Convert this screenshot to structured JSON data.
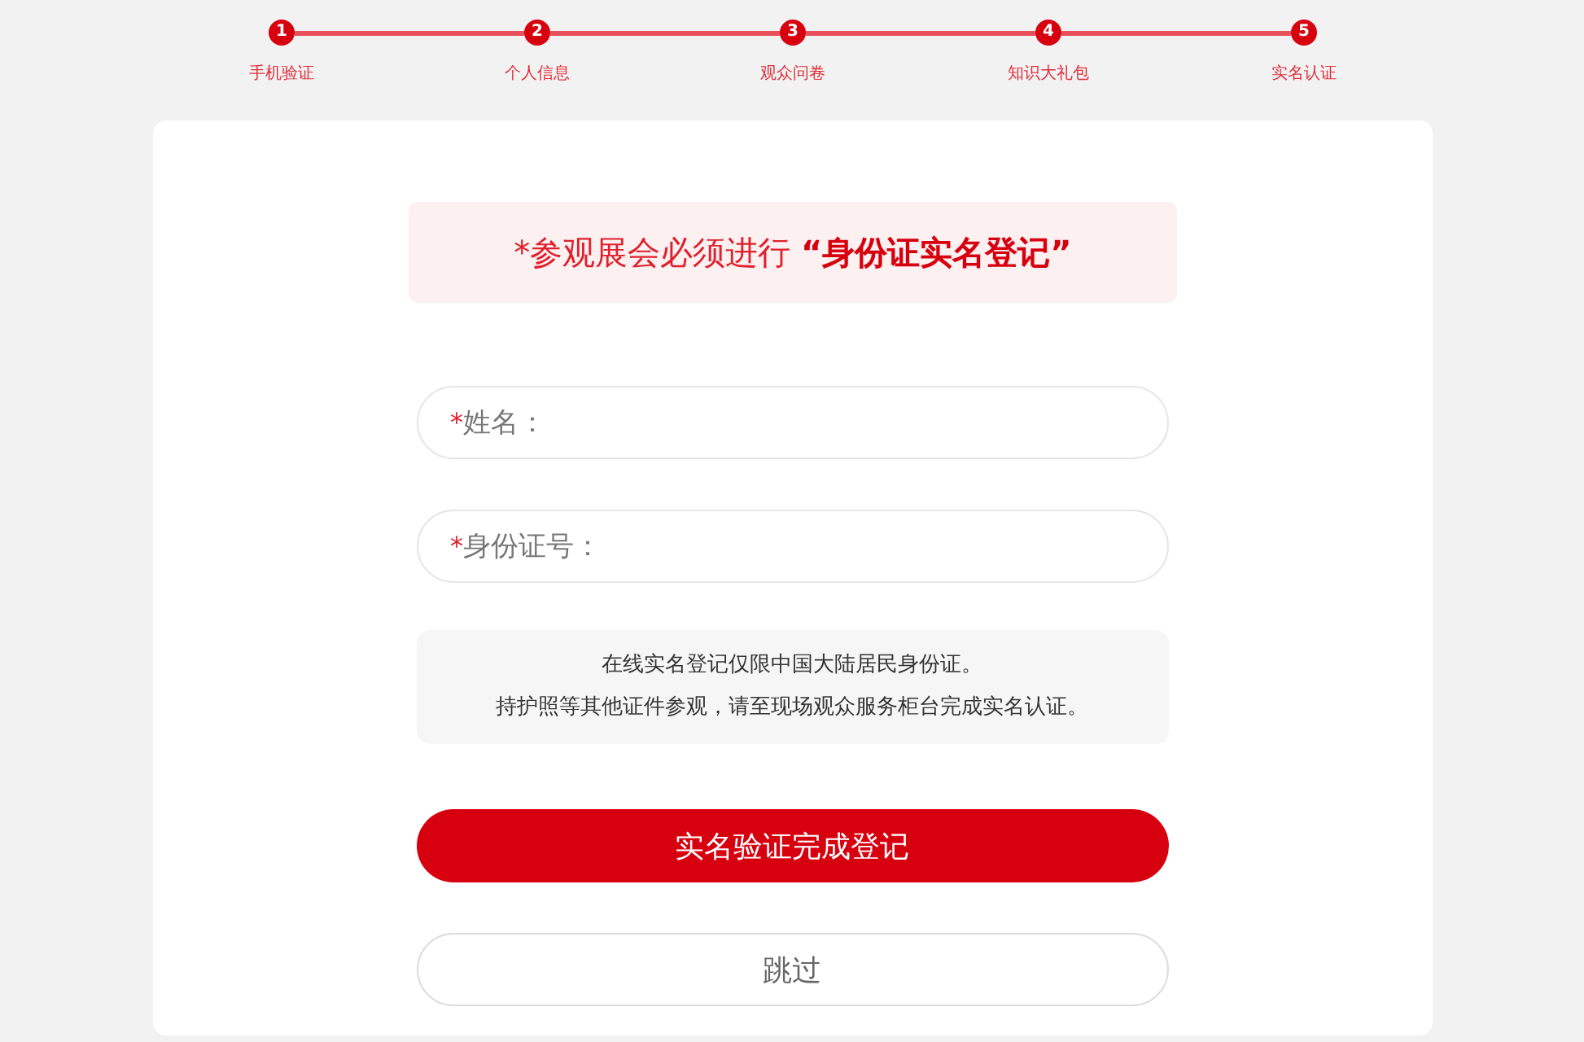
{
  "steps": [
    {
      "number": "1",
      "label": "手机验证",
      "completed": true
    },
    {
      "number": "2",
      "label": "个人信息",
      "completed": true
    },
    {
      "number": "3",
      "label": "观众问卷",
      "completed": true
    },
    {
      "number": "4",
      "label": "知识大礼包",
      "completed": true
    },
    {
      "number": "5",
      "label": "实名认证",
      "completed": true
    }
  ],
  "notice": {
    "text": "*参观展会必须进行 **“身份证实名登记”**"
  },
  "form": {
    "fields": [
      {
        "mark": "*",
        "label": "姓名："
      },
      {
        "mark": "*",
        "label": "身份证号："
      }
    ]
  },
  "info": [
    "在线实名登记仅限中国大陆居民身份证。",
    "持护照等其他证件参观，请至现场观众服务柜台完成实名认证。"
  ],
  "buttons": [
    {
      "kind": "primary",
      "label": "实名验证完成登记"
    },
    {
      "kind": "secondary",
      "label": "跳过"
    }
  ]
}
